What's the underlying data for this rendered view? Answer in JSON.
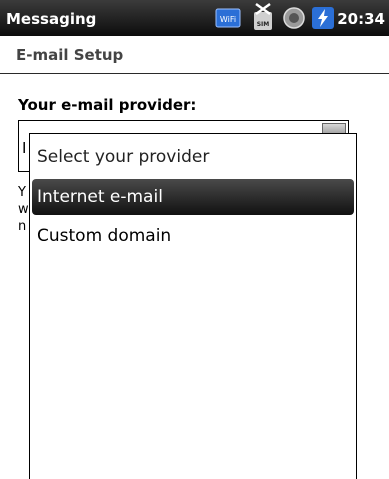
{
  "status_bar": {
    "app_title": "Messaging",
    "time": "20:34",
    "icons": [
      "wifi-icon",
      "no-sim-icon",
      "sync-icon",
      "charging-icon"
    ],
    "wifi_label": "WiFi",
    "sim_label": "SIM"
  },
  "header": {
    "title": "E-mail Setup"
  },
  "form": {
    "label": "Your e-mail provider:",
    "selected_value_partial": "I",
    "description_lines": [
      "Y",
      "w",
      "n"
    ]
  },
  "dropdown": {
    "prompt": "Select your provider",
    "options": [
      {
        "label": "Internet e-mail",
        "selected": true
      },
      {
        "label": "Custom domain",
        "selected": false
      }
    ]
  },
  "colors": {
    "status_bar": "#111111",
    "selected_option": "#1f1f1f",
    "accent_wifi": "#2b6fd6"
  }
}
